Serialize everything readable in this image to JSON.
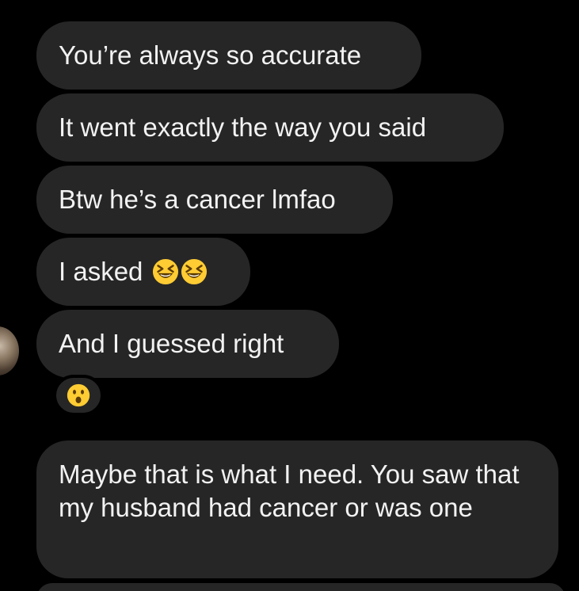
{
  "thread": {
    "messages": [
      {
        "text": "You’re always so accurate"
      },
      {
        "text": "It went exactly the way you said"
      },
      {
        "text": "Btw he’s a cancer lmfao"
      },
      {
        "text": "I asked",
        "emojis": [
          "grinning-squinting-face-icon",
          "grinning-squinting-face-icon"
        ]
      },
      {
        "text": "And I guessed right",
        "reaction": "astonished-face-icon"
      },
      {
        "text": "Maybe that is what I need. You saw that my husband had cancer or was one"
      }
    ]
  },
  "colors": {
    "background": "#000000",
    "bubble": "#262626",
    "text": "#f2f2f2",
    "emoji_face": "#ffcc33"
  }
}
